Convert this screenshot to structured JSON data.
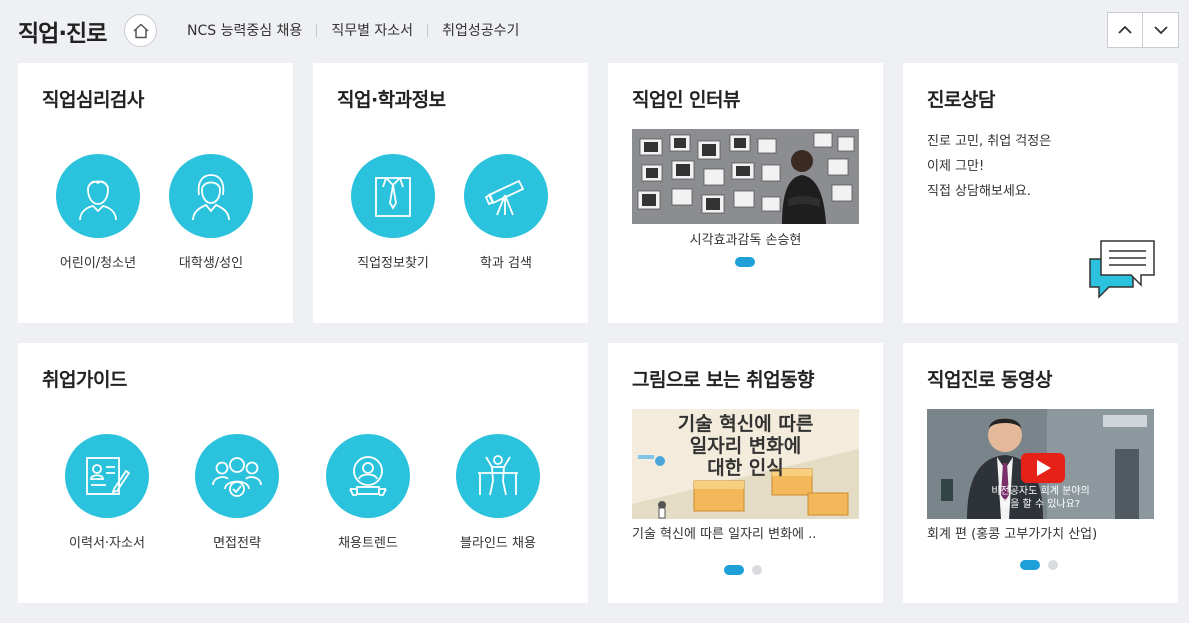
{
  "header": {
    "title": "직업·진로",
    "nav": [
      "NCS 능력중심 채용",
      "직무별 자소서",
      "취업성공수기"
    ]
  },
  "cards": {
    "psych": {
      "title": "직업심리검사",
      "items": [
        "어린이/청소년",
        "대학생/성인"
      ]
    },
    "jobinfo": {
      "title": "직업·학과정보",
      "items": [
        "직업정보찾기",
        "학과 검색"
      ]
    },
    "interview": {
      "title": "직업인 인터뷰",
      "caption": "시각효과감독 손승현"
    },
    "counsel": {
      "title": "진로상담",
      "lines": [
        "진로 고민, 취업 걱정은",
        "이제 그만!",
        "직접 상담해보세요."
      ]
    },
    "guide": {
      "title": "취업가이드",
      "items": [
        "이력서·자소서",
        "면접전략",
        "채용트렌드",
        "블라인드 채용"
      ]
    },
    "trend": {
      "title": "그림으로 보는 취업동향",
      "image_text": [
        "기술 혁신에 따른",
        "일자리 변화에",
        "대한 인식"
      ],
      "caption": "기술 혁신에 따른 일자리 변화에 .."
    },
    "video": {
      "title": "직업진로 동영상",
      "overlay_text": [
        "비전공자도 회계 분야의",
        "일을 할 수 있나요?"
      ],
      "caption": "회계 편 (홍콩 고부가가치 산업)"
    }
  },
  "colors": {
    "accent": "#2ac2dc",
    "dot_active": "#1e9fd8",
    "background": "#eef0f3"
  }
}
